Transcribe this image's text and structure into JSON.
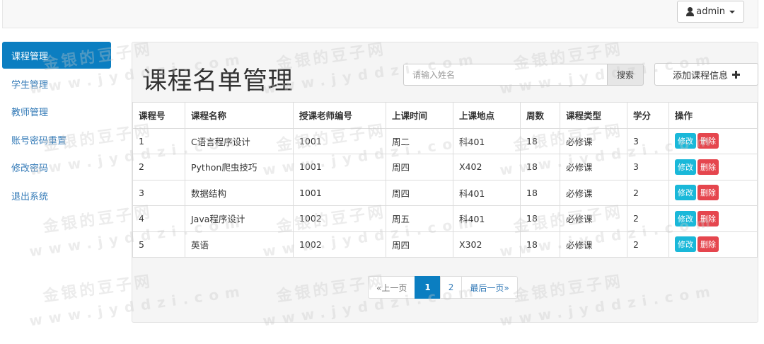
{
  "header": {
    "user_label": "admin"
  },
  "sidebar": {
    "items": [
      {
        "label": "课程管理"
      },
      {
        "label": "学生管理"
      },
      {
        "label": "教师管理"
      },
      {
        "label": "账号密码重置"
      },
      {
        "label": "修改密码"
      },
      {
        "label": "退出系统"
      }
    ]
  },
  "main": {
    "title": "课程名单管理",
    "search": {
      "placeholder": "请输入姓名",
      "button_label": "搜索"
    },
    "add_button_label": "添加课程信息",
    "table": {
      "headers": [
        "课程号",
        "课程名称",
        "授课老师编号",
        "上课时间",
        "上课地点",
        "周数",
        "课程类型",
        "学分",
        "操作"
      ],
      "rows": [
        [
          "1",
          "C语言程序设计",
          "1001",
          "周二",
          "科401",
          "18",
          "必修课",
          "3"
        ],
        [
          "2",
          "Python爬虫技巧",
          "1001",
          "周四",
          "X402",
          "18",
          "必修课",
          "3"
        ],
        [
          "3",
          "数据结构",
          "1001",
          "周四",
          "科401",
          "18",
          "必修课",
          "2"
        ],
        [
          "4",
          "Java程序设计",
          "1002",
          "周五",
          "科401",
          "18",
          "必修课",
          "2"
        ],
        [
          "5",
          "英语",
          "1002",
          "周四",
          "X302",
          "18",
          "必修课",
          "2"
        ]
      ],
      "edit_label": "修改",
      "delete_label": "删除"
    },
    "pagination": {
      "prev": "«上一页",
      "pages": [
        "1",
        "2"
      ],
      "next": "最后一页»"
    }
  },
  "watermark": {
    "cn": "金银的豆子网",
    "en": "www.jyddzi.com"
  },
  "colors": {
    "primary": "#0b7ec1",
    "edit": "#1ab8d9",
    "delete": "#e5464e",
    "link": "#337ab7"
  }
}
